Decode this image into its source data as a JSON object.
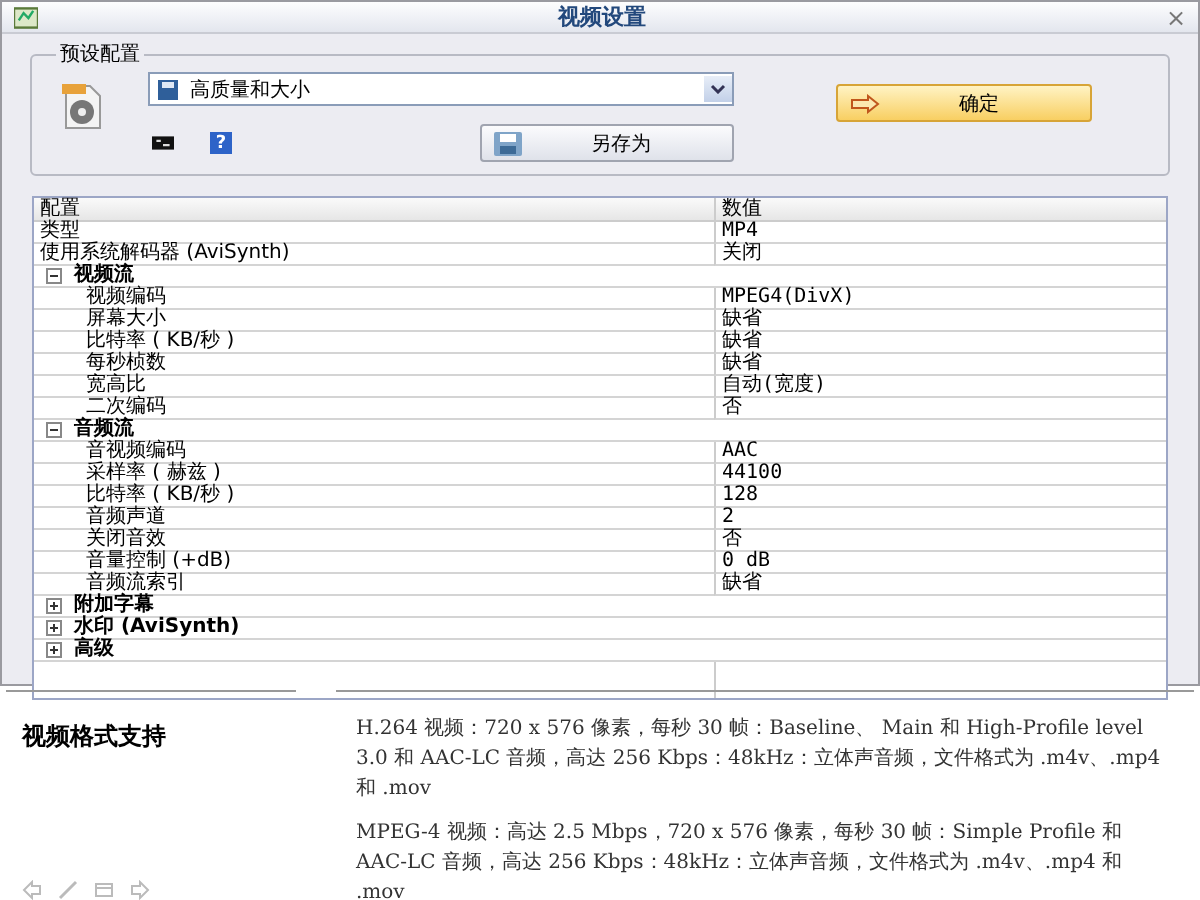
{
  "window": {
    "title": "视频设置",
    "close": "×"
  },
  "preset": {
    "legend": "预设配置",
    "selected_profile": "高质量和大小",
    "ok_button": "确定",
    "save_as_button": "另存为",
    "help": "?"
  },
  "table": {
    "columns": [
      "配置",
      "数值"
    ],
    "rows": [
      {
        "kind": "row",
        "label": "类型",
        "value": "MP4"
      },
      {
        "kind": "row",
        "label": "使用系统解码器 (AviSynth)",
        "value": "关闭"
      },
      {
        "kind": "group",
        "label": "视频流",
        "expanded": true,
        "children": [
          {
            "kind": "row",
            "label": "视频编码",
            "value": "MPEG4(DivX)"
          },
          {
            "kind": "row",
            "label": "屏幕大小",
            "value": "缺省"
          },
          {
            "kind": "row",
            "label": "比特率 ( KB/秒 )",
            "value": "缺省"
          },
          {
            "kind": "row",
            "label": "每秒桢数",
            "value": "缺省"
          },
          {
            "kind": "row",
            "label": "宽高比",
            "value": "自动(宽度)"
          },
          {
            "kind": "row",
            "label": "二次编码",
            "value": "否"
          }
        ]
      },
      {
        "kind": "group",
        "label": "音频流",
        "expanded": true,
        "children": [
          {
            "kind": "row",
            "label": "音视频编码",
            "value": "AAC"
          },
          {
            "kind": "row",
            "label": "采样率 ( 赫兹 )",
            "value": "44100"
          },
          {
            "kind": "row",
            "label": "比特率 ( KB/秒 )",
            "value": "128"
          },
          {
            "kind": "row",
            "label": "音频声道",
            "value": "2"
          },
          {
            "kind": "row",
            "label": "关闭音效",
            "value": "否"
          },
          {
            "kind": "row",
            "label": "音量控制 (+dB)",
            "value": "0 dB"
          },
          {
            "kind": "row",
            "label": "音频流索引",
            "value": "缺省"
          }
        ]
      },
      {
        "kind": "group",
        "label": "附加字幕",
        "expanded": false
      },
      {
        "kind": "group",
        "label": "水印 (AviSynth)",
        "expanded": false
      },
      {
        "kind": "group",
        "label": "高级",
        "expanded": false
      }
    ]
  },
  "article": {
    "heading": "视频格式支持",
    "paragraphs": [
      "H.264 视频：720 x 576 像素，每秒 30 帧：Baseline、 Main 和 High-Profile level 3.0 和 AAC-LC 音频，高达 256 Kbps：48kHz：立体声音频，文件格式为 .m4v、.mp4 和 .mov",
      "MPEG-4 视频：高达 2.5 Mbps，720 x 576 像素，每秒 30 帧：Simple Profile 和 AAC-LC 音频，高达 256 Kbps：48kHz：立体声音频，文件格式为 .m4v、.mp4 和 .mov"
    ]
  }
}
